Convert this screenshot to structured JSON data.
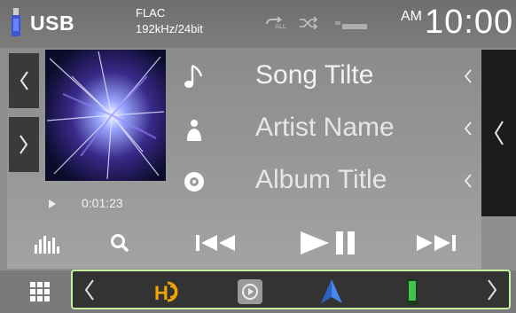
{
  "status_bar": {
    "source": "USB",
    "format": "FLAC",
    "sample_rate": "192kHz/24bit",
    "clock_ampm": "AM",
    "clock_time": "10:00",
    "icons": [
      "usb-icon",
      "repeat-icon",
      "shuffle-icon",
      "battery-icon"
    ]
  },
  "track": {
    "title": "Song Tilte",
    "artist": "Artist Name",
    "album": "Album Title",
    "elapsed": "0:01:23"
  },
  "controls": [
    "equalizer-icon",
    "search-icon",
    "previous-track-icon",
    "play-pause-icon",
    "next-track-icon"
  ],
  "dock": {
    "apps": [
      "hd-radio-app",
      "usb-audio-app",
      "navigation-app",
      "phone-app"
    ]
  },
  "colors": {
    "strip_border": "#c6ef9f",
    "panel_dark": "#1c1c1c"
  }
}
